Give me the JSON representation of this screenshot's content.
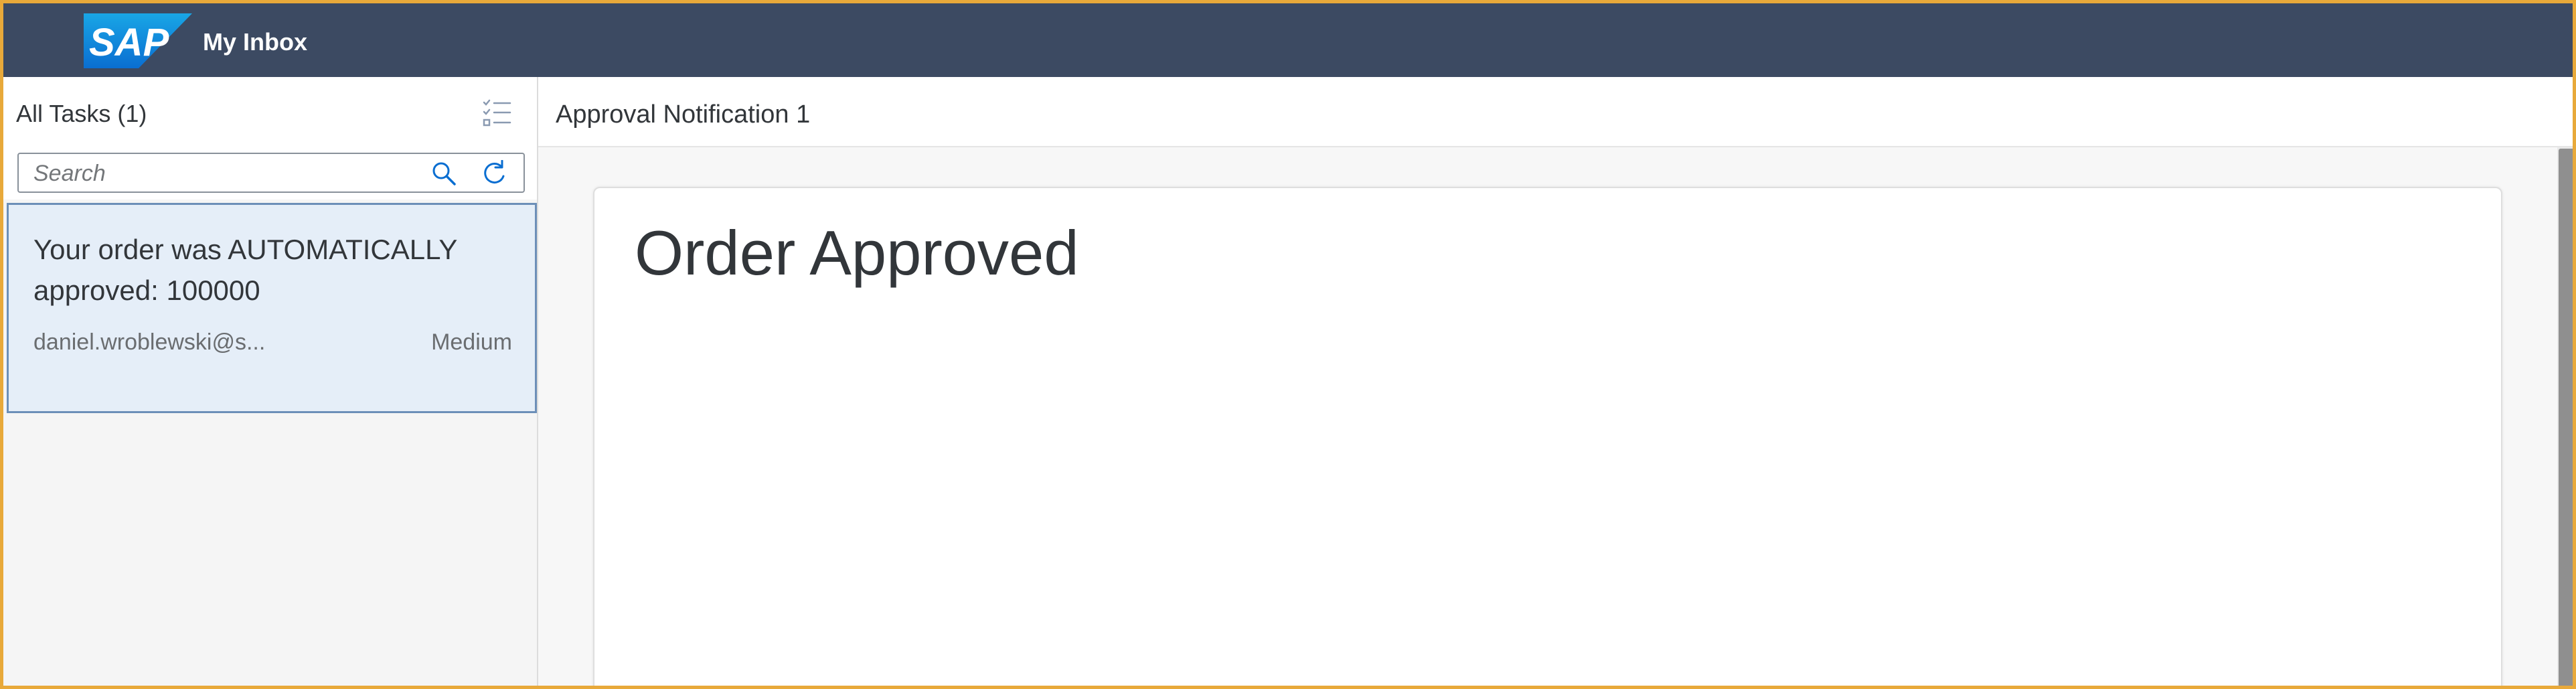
{
  "shell": {
    "logo_text": "SAP",
    "title": "My Inbox",
    "bg_color": "#3c4a62"
  },
  "master": {
    "title": "All Tasks (1)",
    "list_settings_icon": "list-settings-icon",
    "search": {
      "placeholder": "Search",
      "value": "",
      "search_icon": "search-icon",
      "refresh_icon": "refresh-icon"
    },
    "tasks": [
      {
        "title": "Your order was AUTOMATICALLY approved: 100000",
        "owner": "daniel.wroblewski@s...",
        "priority": "Medium",
        "selected": true
      }
    ]
  },
  "detail": {
    "title": "Approval Notification 1",
    "card_heading": "Order Approved"
  },
  "colors": {
    "accent": "#0a6ed1",
    "selection_bg": "#e5eef8",
    "selection_border": "#6c8fb8",
    "frame_border": "#e8a93a"
  }
}
